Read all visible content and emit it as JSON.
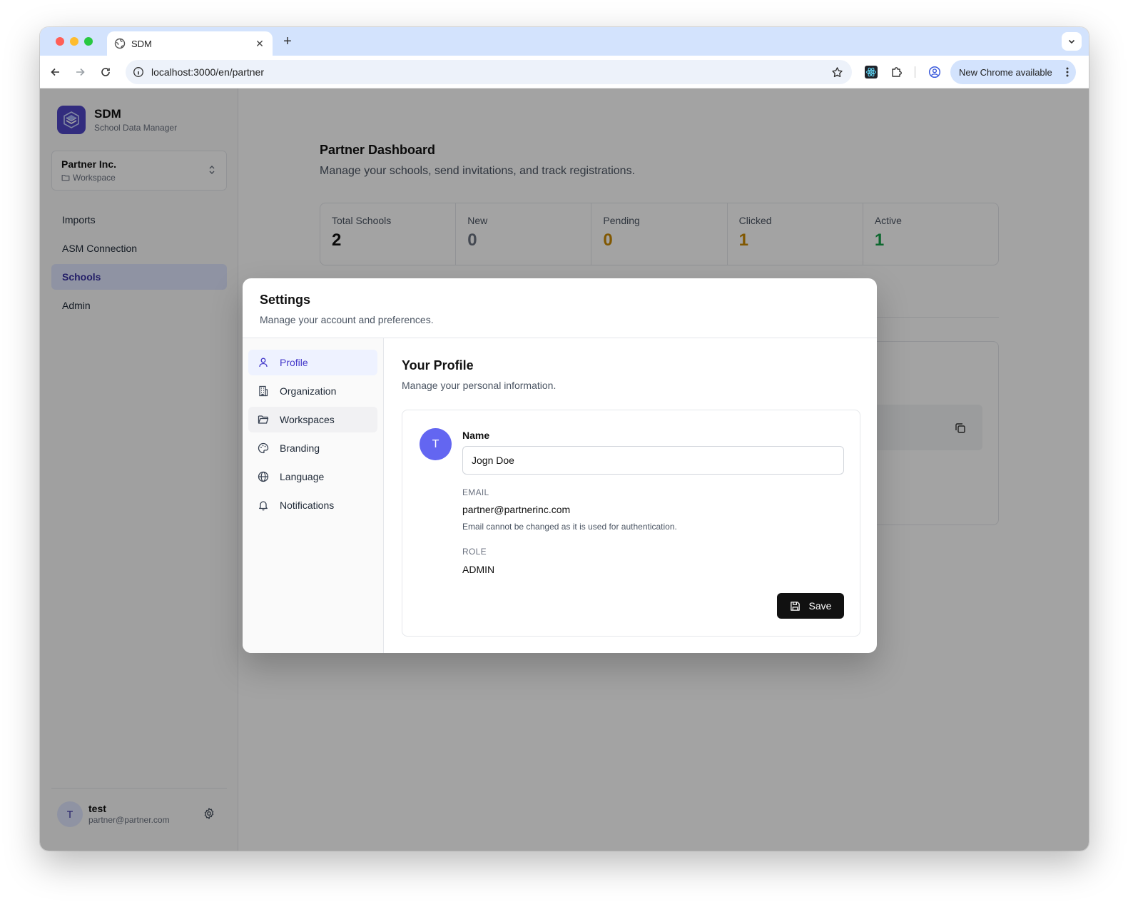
{
  "browser": {
    "tab_title": "SDM",
    "url": "localhost:3000/en/partner",
    "update_label": "New Chrome available"
  },
  "sidebar": {
    "brand_name": "SDM",
    "brand_subtitle": "School Data Manager",
    "workspace_name": "Partner Inc.",
    "workspace_label": "Workspace",
    "items": [
      {
        "label": "Imports"
      },
      {
        "label": "ASM Connection"
      },
      {
        "label": "Schools",
        "active": true
      },
      {
        "label": "Admin"
      }
    ],
    "user": {
      "initial": "T",
      "name": "test",
      "email": "partner@partner.com"
    }
  },
  "dashboard": {
    "title": "Partner Dashboard",
    "subtitle": "Manage your schools, send invitations, and track registrations.",
    "stats": [
      {
        "label": "Total Schools",
        "value": "2",
        "color": "#111111"
      },
      {
        "label": "New",
        "value": "0",
        "color": "#6b7280"
      },
      {
        "label": "Pending",
        "value": "0",
        "color": "#ca8a04"
      },
      {
        "label": "Clicked",
        "value": "1",
        "color": "#ca8a04"
      },
      {
        "label": "Active",
        "value": "1",
        "color": "#16a34a"
      }
    ]
  },
  "settings": {
    "title": "Settings",
    "subtitle": "Manage your account and preferences.",
    "nav": [
      {
        "label": "Profile",
        "icon": "user-icon"
      },
      {
        "label": "Organization",
        "icon": "building-icon"
      },
      {
        "label": "Workspaces",
        "icon": "folder-icon"
      },
      {
        "label": "Branding",
        "icon": "palette-icon"
      },
      {
        "label": "Language",
        "icon": "globe-icon"
      },
      {
        "label": "Notifications",
        "icon": "bell-icon"
      }
    ],
    "profile": {
      "title": "Your Profile",
      "subtitle": "Manage your personal information.",
      "avatar_initial": "T",
      "name_label": "Name",
      "name_value": "Jogn Doe",
      "email_label": "EMAIL",
      "email_value": "partner@partnerinc.com",
      "email_hint": "Email cannot be changed as it is used for authentication.",
      "role_label": "ROLE",
      "role_value": "ADMIN",
      "save_label": "Save"
    }
  }
}
